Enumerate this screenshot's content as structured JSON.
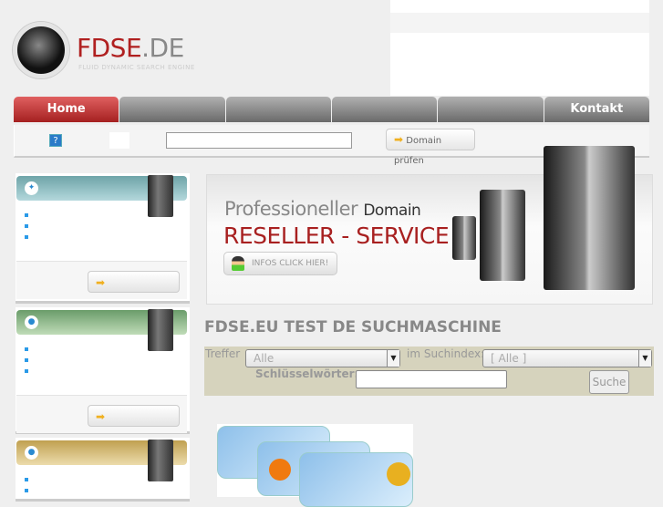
{
  "logo": {
    "title_main": "FDSE",
    "title_suffix": ".DE",
    "tagline": "FLUID DYNAMIC SEARCH ENGINE"
  },
  "nav": {
    "tabs": [
      {
        "label": "Home"
      },
      {
        "label": ""
      },
      {
        "label": ""
      },
      {
        "label": ""
      },
      {
        "label": ""
      },
      {
        "label": "Kontakt"
      }
    ]
  },
  "domain_check": {
    "help_icon": "?",
    "input_value": "",
    "button_label": "Domain prüfen"
  },
  "banner": {
    "line1_light": "Professioneller",
    "line1_dark": "Domain",
    "line2": "RESELLER - SERVICE",
    "button_label": "INFOS CLICK HIER!"
  },
  "search": {
    "title": "FDSE.EU TEST DE SUCHMASCHINE",
    "treffer_label": "Treffer",
    "treffer_value": "Alle",
    "index_label": "im Suchindex:",
    "index_value": "[ Alle ]",
    "keywords_label": "Schlüsselwörter:",
    "keywords_value": "",
    "submit_label": "Suche"
  },
  "colors": {
    "accent_red": "#a82020",
    "box1": "#7aacb0",
    "box2": "#7aa87a",
    "box3": "#c8b060"
  }
}
